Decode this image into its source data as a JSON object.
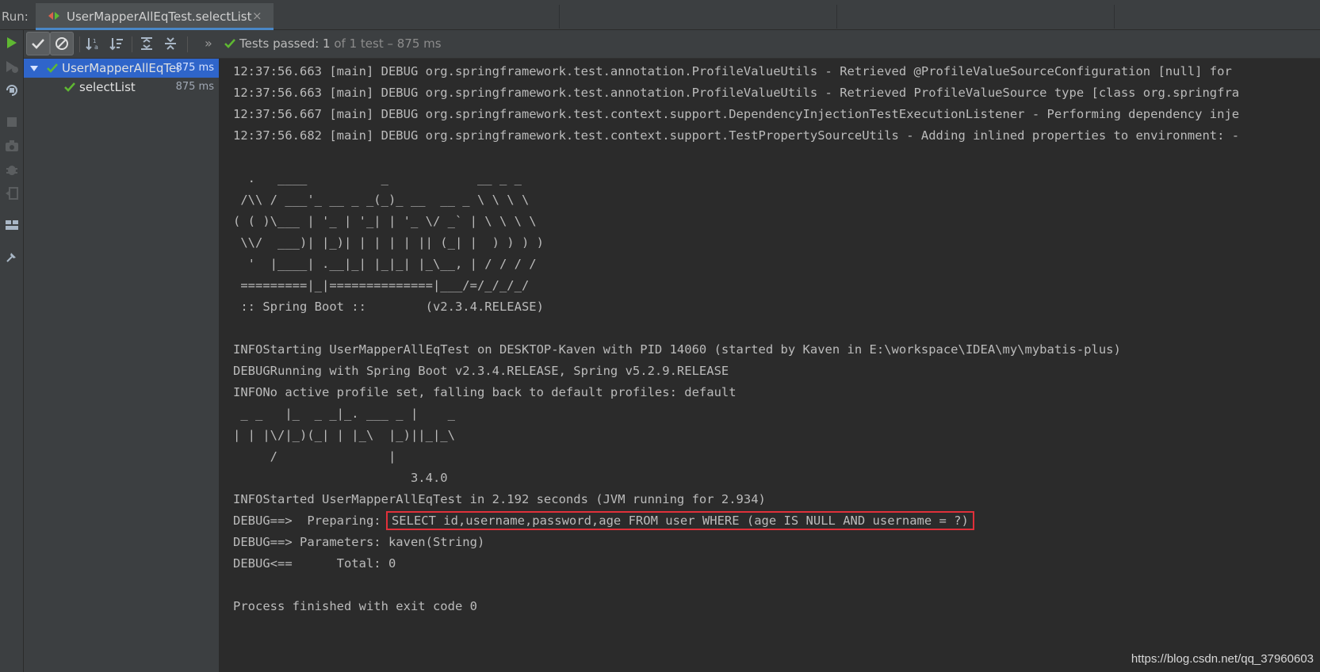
{
  "header": {
    "run_label": "Run:",
    "tab_title": "UserMapperAllEqTest.selectList",
    "tab_close": "×"
  },
  "toolbar": {
    "expand_chevron": "»",
    "status_prefix": "Tests passed: ",
    "passed_count": "1",
    "status_suffix": " of 1 test – 875 ms"
  },
  "tree": {
    "root": {
      "label": "UserMapperAllEqTest",
      "time": "875 ms"
    },
    "child": {
      "label": "selectList",
      "time": "875 ms"
    }
  },
  "console": {
    "lines": [
      "12:37:56.663 [main] DEBUG org.springframework.test.annotation.ProfileValueUtils - Retrieved @ProfileValueSourceConfiguration [null] for",
      "12:37:56.663 [main] DEBUG org.springframework.test.annotation.ProfileValueUtils - Retrieved ProfileValueSource type [class org.springfra",
      "12:37:56.667 [main] DEBUG org.springframework.test.context.support.DependencyInjectionTestExecutionListener - Performing dependency inje",
      "12:37:56.682 [main] DEBUG org.springframework.test.context.support.TestPropertySourceUtils - Adding inlined properties to environment: -",
      "",
      "  .   ____          _            __ _ _",
      " /\\\\ / ___'_ __ _ _(_)_ __  __ _ \\ \\ \\ \\",
      "( ( )\\___ | '_ | '_| | '_ \\/ _` | \\ \\ \\ \\",
      " \\\\/  ___)| |_)| | | | | || (_| |  ) ) ) )",
      "  '  |____| .__|_| |_|_| |_\\__, | / / / /",
      " =========|_|==============|___/=/_/_/_/",
      " :: Spring Boot ::        (v2.3.4.RELEASE)",
      "",
      "INFOStarting UserMapperAllEqTest on DESKTOP-Kaven with PID 14060 (started by Kaven in E:\\workspace\\IDEA\\my\\mybatis-plus)",
      "DEBUGRunning with Spring Boot v2.3.4.RELEASE, Spring v5.2.9.RELEASE",
      "INFONo active profile set, falling back to default profiles: default",
      " _ _   |_  _ _|_. ___ _ |    _",
      "| | |\\/|_)(_| | |_\\  |_)||_|_\\",
      "     /               |",
      "                        3.4.0",
      "INFOStarted UserMapperAllEqTest in 2.192 seconds (JVM running for 2.934)"
    ],
    "prep_prefix": "DEBUG==>  Preparing: ",
    "prep_sql": "SELECT id,username,password,age FROM user WHERE (age IS NULL AND username = ?)",
    "params_line": "DEBUG==> Parameters: kaven(String)",
    "total_line": "DEBUG<==      Total: 0",
    "finish_line": "Process finished with exit code 0"
  },
  "watermark": "https://blog.csdn.net/qq_37960603",
  "colors": {
    "panel_bg": "#3c3f41",
    "console_bg": "#2b2b2b",
    "selection": "#2f65ca",
    "pass_green": "#5fb832",
    "highlight_box": "#e0303a"
  }
}
